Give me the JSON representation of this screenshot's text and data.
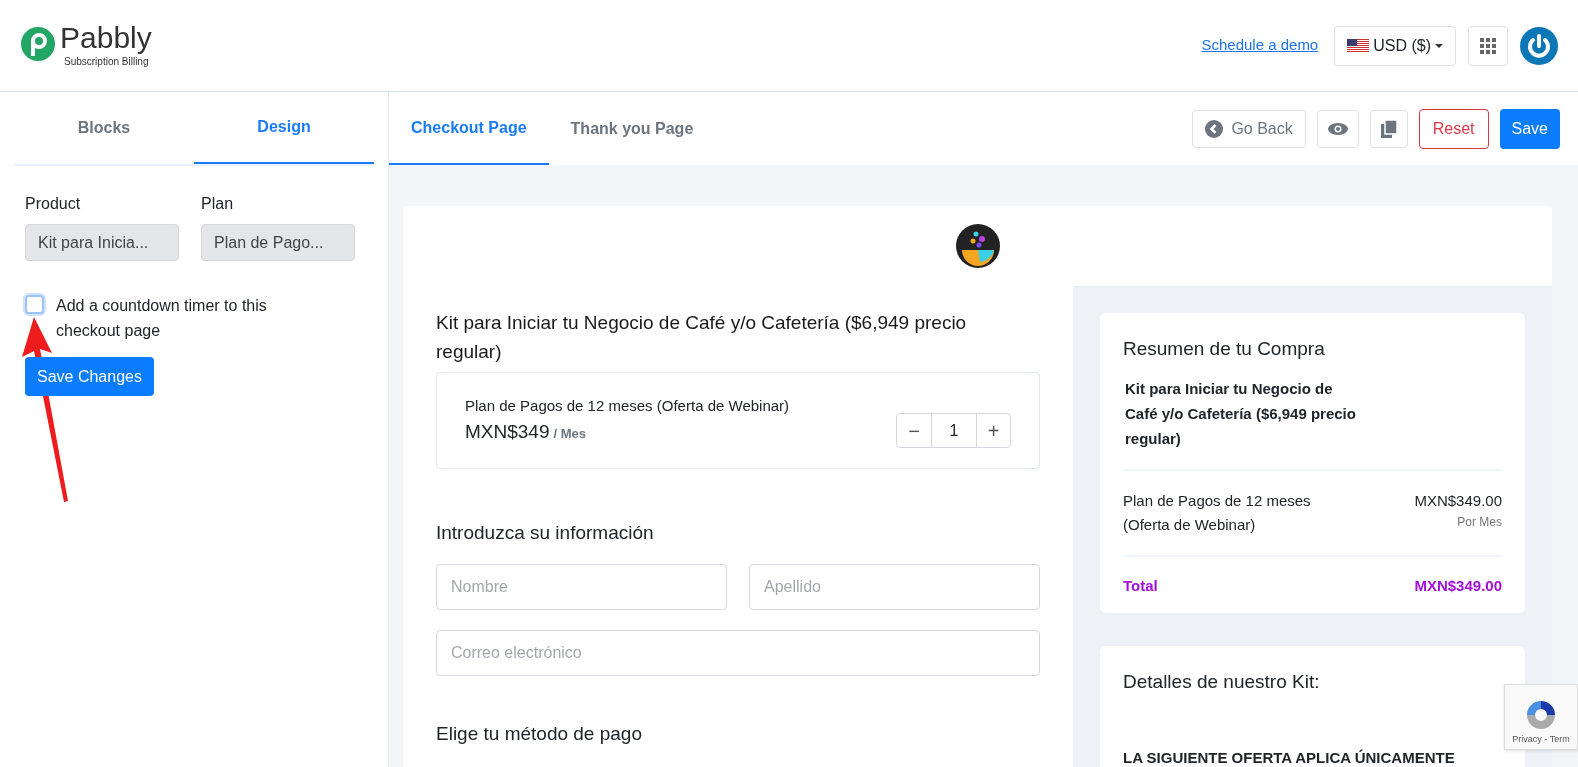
{
  "header": {
    "logo": {
      "name": "Pabbly",
      "tagline": "Subscription Billing"
    },
    "demo_link": "Schedule a demo",
    "currency": "USD ($)"
  },
  "sidebar": {
    "tabs": [
      {
        "label": "Blocks",
        "selected": false
      },
      {
        "label": "Design",
        "selected": true
      }
    ],
    "fields": [
      {
        "label": "Product",
        "value": "Kit para Inicia..."
      },
      {
        "label": "Plan",
        "value": "Plan de Pago..."
      }
    ],
    "countdown": {
      "label": "Add a countdown timer to this checkout page",
      "checked": false
    },
    "save_button": "Save Changes"
  },
  "editor": {
    "tabs": [
      {
        "label": "Checkout Page",
        "selected": true
      },
      {
        "label": "Thank you Page",
        "selected": false
      }
    ],
    "go_back": "Go Back",
    "reset": "Reset",
    "save": "Save"
  },
  "checkout": {
    "product_title": "Kit para Iniciar tu Negocio de Café y/o Cafetería ($6,949 precio regular)",
    "plan": {
      "name": "Plan de Pagos de 12 meses (Oferta de Webinar)",
      "price": "MXN$349",
      "period": "/ Mes",
      "quantity": "1",
      "minus": "−",
      "plus": "+"
    },
    "info_heading": "Introduzca su información",
    "fields": [
      {
        "placeholder": "Nombre"
      },
      {
        "placeholder": "Apellido"
      },
      {
        "placeholder": "Correo electrónico"
      }
    ],
    "payment_heading": "Elige tu método de pago"
  },
  "summary": {
    "title": "Resumen de tu Compra",
    "product": "Kit para Iniciar tu Negocio de Café y/o Cafetería ($6,949 precio regular)",
    "line": {
      "name": "Plan de Pagos de 12 meses (Oferta de Webinar)",
      "price": "MXN$349.00",
      "period": "Por Mes"
    },
    "total": {
      "label": "Total",
      "value": "MXN$349.00"
    },
    "details_title": "Detalles de nuestro Kit:",
    "offer_text": "LA SIGUIENTE OFERTA APLICA ÚNICAMENTE"
  },
  "recaptcha": {
    "text": "Privacy - Term"
  }
}
